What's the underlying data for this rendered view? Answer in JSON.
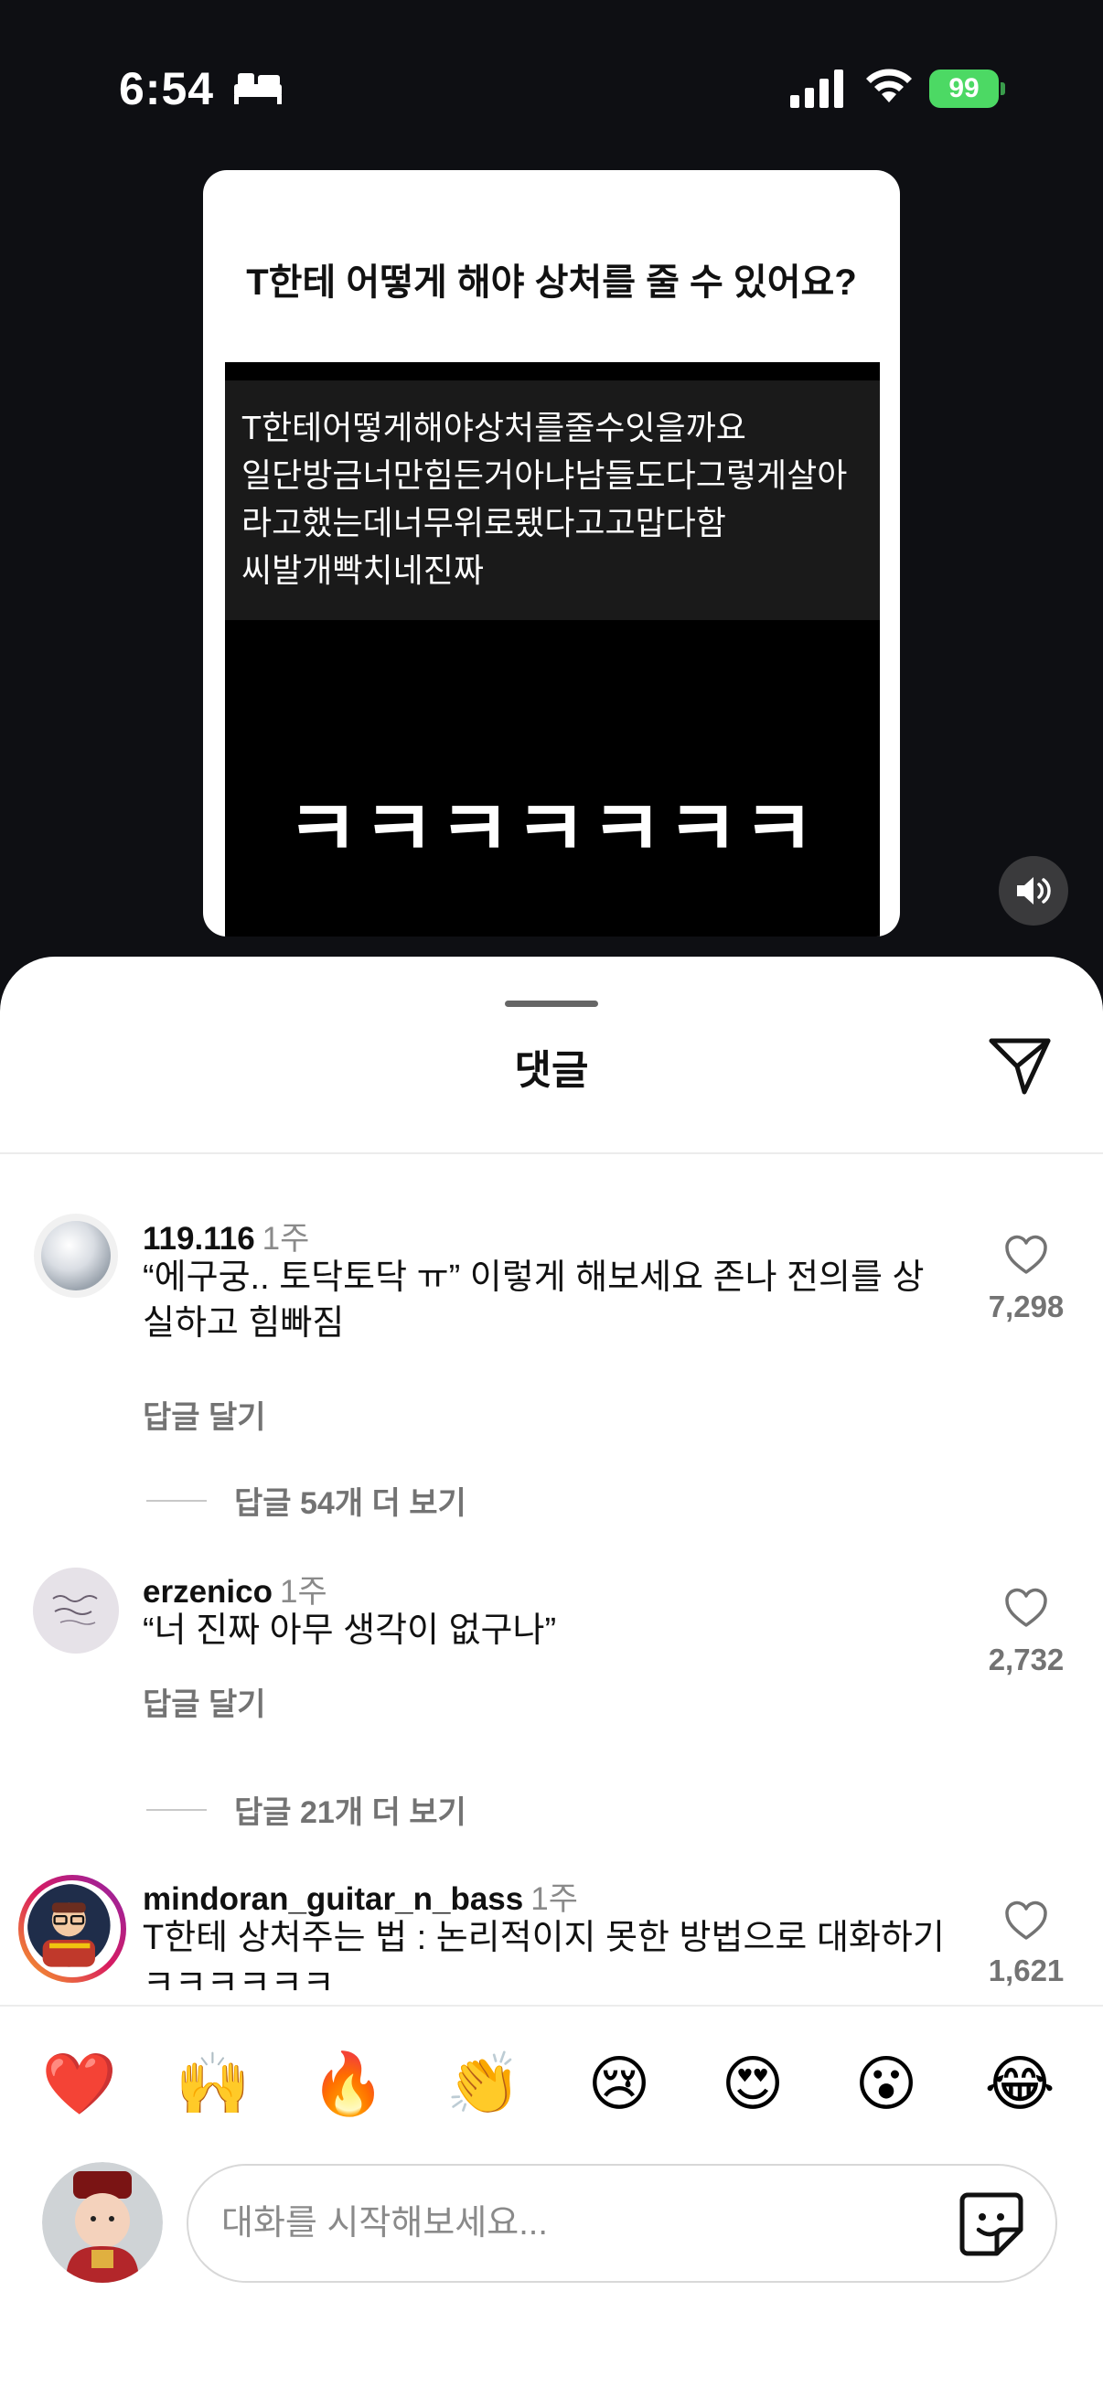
{
  "status": {
    "time": "6:54",
    "battery": "99"
  },
  "post": {
    "title": "T한테 어떻게 해야 상처를 줄 수 있어요?",
    "text_lines": [
      "T한테어떻게해야상처를줄수잇을까요",
      "일단방금너만힘든거아냐남들도다그렇게살아",
      "라고했는데너무위로됐다고고맙다함",
      "씨발개빡치네진짜"
    ],
    "big_text": "ㅋㅋㅋㅋㅋㅋㅋ"
  },
  "sheet": {
    "title": "댓글"
  },
  "comments": [
    {
      "user": "119.116",
      "time": "1주",
      "text": "“에구궁.. 토닥토닥 ㅠ” 이렇게 해보세요 존나 전의를 상실하고 힘빠짐",
      "reply": "답글 달기",
      "likes": "7,298",
      "more": "답글 54개 더 보기"
    },
    {
      "user": "erzenico",
      "time": "1주",
      "text": "“너 진짜 아무 생각이 없구나”",
      "reply": "답글 달기",
      "likes": "2,732",
      "more": "답글 21개 더 보기"
    },
    {
      "user": "mindoran_guitar_n_bass",
      "time": "1주",
      "text": "T한테 상처주는 법 : 논리적이지 못한 방법으로 대화하기 ㅋㅋㅋㅋㅋㅋ",
      "likes": "1,621"
    }
  ],
  "emojis": [
    "❤️",
    "🙌",
    "🔥",
    "👏",
    "😢",
    "😍",
    "😮",
    "😂"
  ],
  "input": {
    "placeholder": "대화를 시작해보세요..."
  },
  "colors": {
    "battery": "#4cd964",
    "story_ring_start": "#f9a825",
    "story_ring_end": "#d81b60"
  }
}
